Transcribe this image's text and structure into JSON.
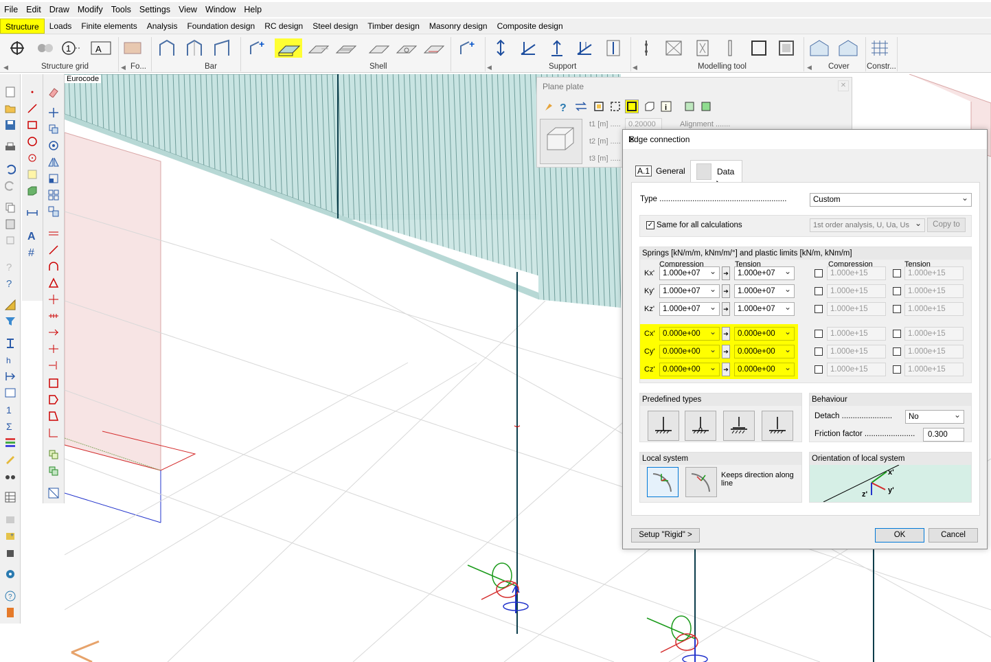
{
  "menu": [
    "File",
    "Edit",
    "Draw",
    "Modify",
    "Tools",
    "Settings",
    "View",
    "Window",
    "Help"
  ],
  "modules": [
    "Structure",
    "Loads",
    "Finite elements",
    "Analysis",
    "Foundation design",
    "RC design",
    "Steel design",
    "Timber design",
    "Masonry design",
    "Composite design"
  ],
  "active_module": "Structure",
  "ribbon_groups": {
    "structure_grid": "Structure grid",
    "fo": "Fo...",
    "bar": "Bar",
    "shell": "Shell",
    "support": "Support",
    "modelling_tool": "Modelling tool",
    "cover": "Cover",
    "constr": "Constr..."
  },
  "ribbon_text_icons": {
    "grid_one": "1",
    "grid_a": "A"
  },
  "viewport": {
    "code_label": "Eurocode"
  },
  "plane_plate": {
    "title": "Plane plate",
    "t1_label": "t1 [m] .....",
    "t2_label": "t2 [m] .....",
    "t3_label": "t3 [m] .....",
    "t1_value": "0.20000",
    "alignment_label": "Alignment ......."
  },
  "dialog": {
    "title": "Edge connection",
    "tab_general_icon": "A.1",
    "tab_general": "General",
    "tab_data": "Data",
    "type_label": "Type",
    "type_value": "Custom",
    "same_for_all": "Same for all calculations",
    "analysis_value": "1st order analysis, U, Ua, Us",
    "copy_to": "Copy to",
    "springs_header": "Springs [kN/m/m, kNm/m/°] and plastic limits [kN/m, kNm/m]",
    "col_compression": "Compression",
    "col_tension": "Tension",
    "col_compression2": "Compression",
    "col_tension2": "Tension",
    "rows": [
      {
        "label": "Kx'",
        "comp": "1.000e+07",
        "tens": "1.000e+07",
        "lim_c": "1.000e+15",
        "lim_t": "1.000e+15"
      },
      {
        "label": "Ky'",
        "comp": "1.000e+07",
        "tens": "1.000e+07",
        "lim_c": "1.000e+15",
        "lim_t": "1.000e+15"
      },
      {
        "label": "Kz'",
        "comp": "1.000e+07",
        "tens": "1.000e+07",
        "lim_c": "1.000e+15",
        "lim_t": "1.000e+15"
      },
      {
        "label": "Cx'",
        "comp": "0.000e+00",
        "tens": "0.000e+00",
        "lim_c": "1.000e+15",
        "lim_t": "1.000e+15"
      },
      {
        "label": "Cy'",
        "comp": "0.000e+00",
        "tens": "0.000e+00",
        "lim_c": "1.000e+15",
        "lim_t": "1.000e+15"
      },
      {
        "label": "Cz'",
        "comp": "0.000e+00",
        "tens": "0.000e+00",
        "lim_c": "1.000e+15",
        "lim_t": "1.000e+15"
      }
    ],
    "predefined_types": "Predefined types",
    "behaviour": "Behaviour",
    "detach_label": "Detach",
    "detach_value": "No",
    "friction_label": "Friction factor",
    "friction_value": "0.300",
    "local_system": "Local system",
    "keeps_direction": "Keeps direction along line",
    "orientation": "Orientation of local system",
    "orient_x": "x'",
    "orient_y": "y'",
    "orient_z": "z'",
    "setup_button": "Setup \"Rigid\" >",
    "ok": "OK",
    "cancel": "Cancel"
  },
  "colors": {
    "highlight": "#ffff00",
    "plate": "#c8e4e2",
    "accent": "#0078d7"
  }
}
